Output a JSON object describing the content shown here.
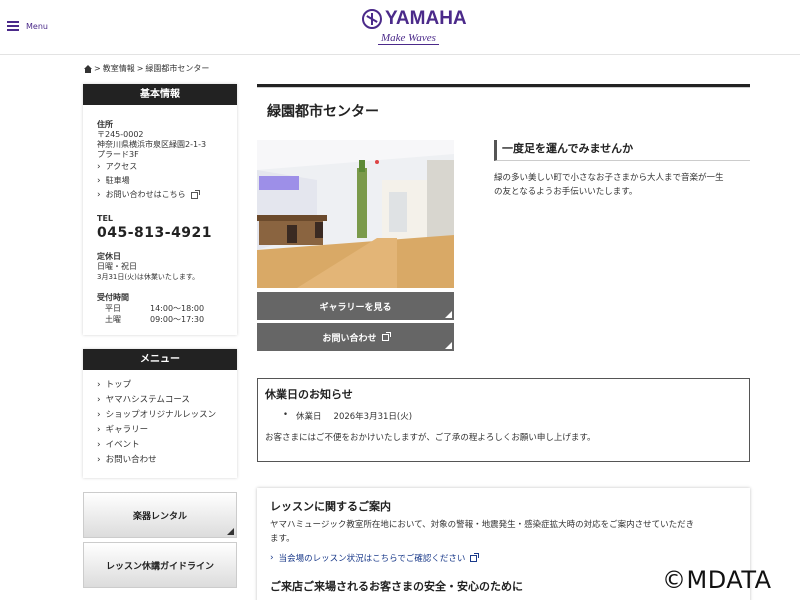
{
  "header": {
    "menu_label": "Menu",
    "logo_text": "YAMAHA",
    "logo_tagline": "Make Waves"
  },
  "breadcrumb": {
    "items": [
      "教室情報",
      "緑園都市センター"
    ]
  },
  "sidebar": {
    "info": {
      "heading": "基本情報",
      "address_label": "住所",
      "postal": "〒245-0002",
      "address": "神奈川県横浜市泉区緑園2-1-3",
      "building": "プラード3F",
      "links": [
        "アクセス",
        "駐車場",
        "お問い合わせはこちら"
      ],
      "tel_label": "TEL",
      "tel": "045-813-4921",
      "closed_label": "定休日",
      "closed_text": "日曜・祝日",
      "closed_note": "3月31日(火)は休業いたします。",
      "hours_label": "受付時間",
      "hours": [
        {
          "day": "平日",
          "time": "14:00〜18:00"
        },
        {
          "day": "土曜",
          "time": "09:00〜17:30"
        }
      ]
    },
    "menu": {
      "heading": "メニュー",
      "items": [
        "トップ",
        "ヤマハシステムコース",
        "ショップオリジナルレッスン",
        "ギャラリー",
        "イベント",
        "お問い合わせ"
      ]
    },
    "buttons": [
      "楽器レンタル",
      "レッスン休講ガイドライン"
    ]
  },
  "main": {
    "title": "緑園都市センター",
    "gallery_button": "ギャラリーを見る",
    "contact_button": "お問い合わせ",
    "intro_heading": "一度足を運んでみませんか",
    "intro_text_1": "緑の多い美しい町で小さなお子さまから大人まで音楽が一生",
    "intro_text_2": "の友となるようお手伝いいたします。",
    "notice": {
      "title": "休業日のお知らせ",
      "item_label": "休業日",
      "item_date": "2026年3月31日(火)",
      "text": "お客さまにはご不便をおかけいたしますが、ご了承の程よろしくお願い申し上げます。"
    },
    "lesson": {
      "title": "レッスンに関するご案内",
      "text_1": "ヤマハミュージック教室所在地において、対象の警報・地震発生・感染症拡大時の対応をご案内させていただき",
      "text_2": "ます。",
      "link": "当会場のレッスン状況はこちらでご確認ください",
      "sub_title": "ご来店ご来場されるお客さまの安全・安心のために"
    }
  },
  "watermark": "©MDATA",
  "colors": {
    "brand": "#4b2a8a",
    "sidebar_head": "#222222",
    "button_dark": "#666666",
    "link": "#1a3a8a"
  }
}
